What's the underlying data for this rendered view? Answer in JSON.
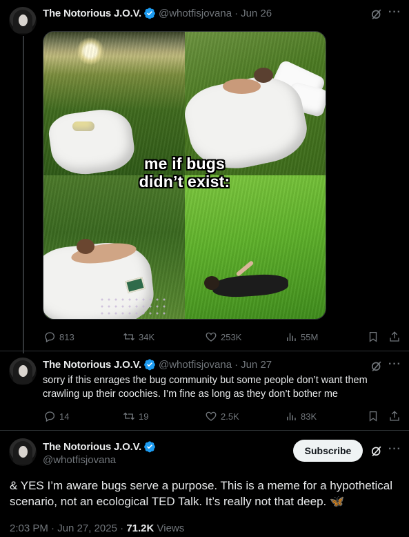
{
  "tweet1": {
    "name": "The Notorious J.O.V.",
    "handle": "@whotfisjovana",
    "sep": "·",
    "date": "Jun 26",
    "caption_line1": "me if bugs",
    "caption_line2": "didn’t exist:",
    "replies": "813",
    "reposts": "34K",
    "likes": "253K",
    "views": "55M"
  },
  "tweet2": {
    "name": "The Notorious J.O.V.",
    "handle": "@whotfisjovana",
    "sep": "·",
    "date": "Jun 27",
    "text": "sorry if this enrages the bug community but some people don’t want them crawling up their coochies. I’m fine as long as they don’t bother me",
    "replies": "14",
    "reposts": "19",
    "likes": "2.5K",
    "views": "83K"
  },
  "tweet3": {
    "name": "The Notorious J.O.V.",
    "handle": "@whotfisjovana",
    "subscribe_label": "Subscribe",
    "text": "& YES I’m aware bugs serve a purpose. This is a meme for a hypothetical scenario, not an ecological TED Talk. It’s really not that deep.",
    "emoji": "🦋",
    "time": "2:03 PM",
    "sep": "·",
    "date": "Jun 27, 2025",
    "meta_sep": "·",
    "views_count": "71.2K",
    "views_label": "Views"
  },
  "icons": {
    "more": "···",
    "verified": "verified-badge-icon",
    "grok": "grok-icon",
    "reply": "reply-icon",
    "repost": "repost-icon",
    "like": "heart-icon",
    "views": "views-chart-icon",
    "bookmark": "bookmark-icon",
    "share": "share-icon"
  },
  "colors": {
    "background": "#000000",
    "text": "#e7e9ea",
    "muted": "#71767b",
    "verified": "#1d9bf0",
    "butterfly": "#4aa3f0"
  }
}
